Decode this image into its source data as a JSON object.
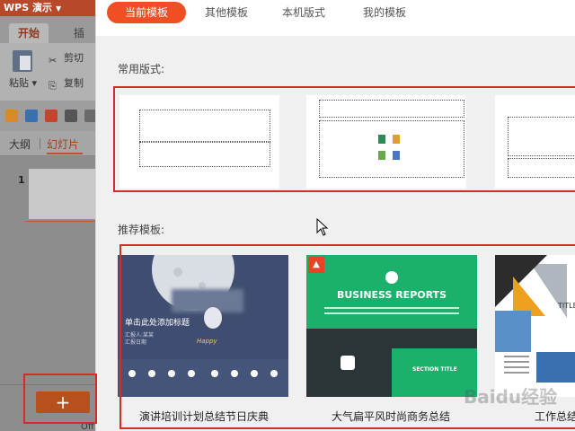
{
  "app": {
    "title": "WPS 演示",
    "ribbon_tabs": [
      "开始",
      "插入"
    ],
    "paste_label": "粘贴",
    "cut_label": "剪切",
    "copy_label": "复制",
    "view_tabs": [
      "大纲",
      "幻灯片"
    ],
    "slide_number": "1",
    "add_slide_label": "+",
    "footer_cut_text": "Off"
  },
  "dialog": {
    "tabs": [
      "当前模板",
      "其他模板",
      "本机版式",
      "我的模板"
    ],
    "active_tab": "当前模板",
    "common_layouts_title": "常用版式:",
    "recommended_title": "推荐模板:",
    "templates": [
      {
        "name": "演讲培训计划总结节日庆典",
        "slide_title": "单击此处添加标题",
        "line1": "汇报人:某某",
        "line2": "汇报日期",
        "script": "Happy"
      },
      {
        "name": "大气扁平风时尚商务总结",
        "slide_title": "BUSINESS REPORTS",
        "section": "SECTION TITLE"
      },
      {
        "name": "工作总结",
        "side_label": "TITLE"
      }
    ]
  },
  "watermark": "Baidu经验",
  "colors": {
    "accent": "#f04e23",
    "title_bar": "#b7482a",
    "highlight": "#d42b2b",
    "business_green": "#1bb06b"
  }
}
